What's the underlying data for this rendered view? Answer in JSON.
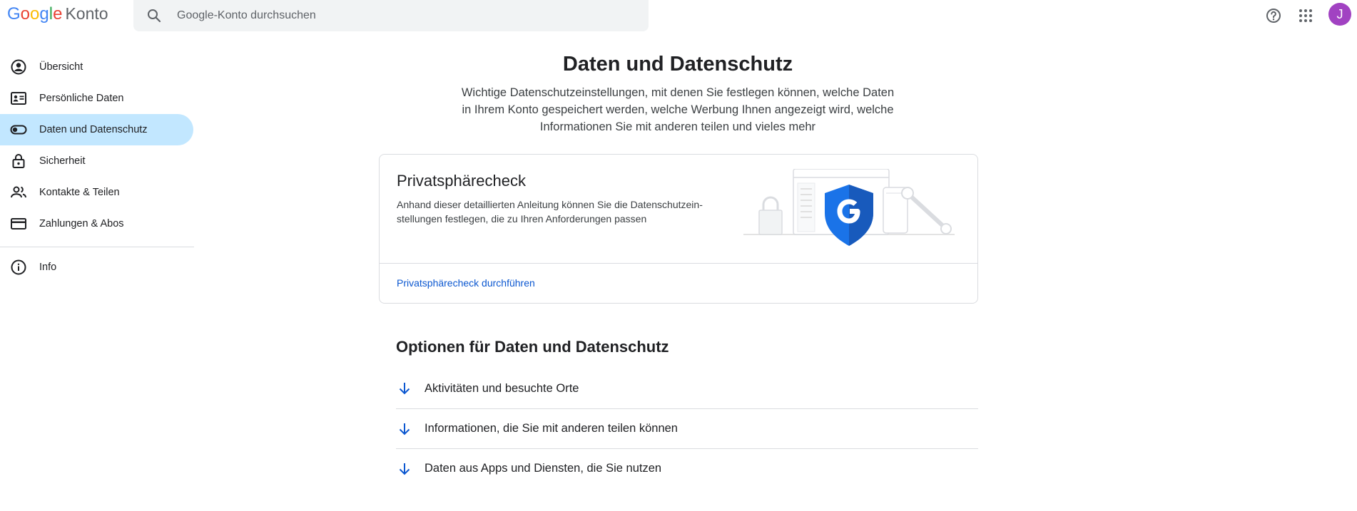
{
  "header": {
    "logo_letters": [
      "G",
      "o",
      "o",
      "g",
      "l",
      "e"
    ],
    "logo_colors": [
      "#4285f4",
      "#ea4335",
      "#fbbc05",
      "#4285f4",
      "#34a853",
      "#ea4335"
    ],
    "product": "Konto",
    "search_placeholder": "Google-Konto durchsuchen",
    "search_value": "",
    "icons": [
      "search-icon",
      "help-icon",
      "apps-grid-icon"
    ],
    "avatar_initial": "J",
    "avatar_color": "#a142c2"
  },
  "sidebar": {
    "active_color": "#c2e7ff",
    "items": [
      {
        "label": "Übersicht",
        "icon": "account-circle-icon",
        "active": false
      },
      {
        "label": "Persönliche Daten",
        "icon": "id-card-icon",
        "active": false
      },
      {
        "label": "Daten und Datenschutz",
        "icon": "toggle-icon",
        "active": true
      },
      {
        "label": "Sicherheit",
        "icon": "lock-icon",
        "active": false
      },
      {
        "label": "Kontakte & Teilen",
        "icon": "people-icon",
        "active": false
      },
      {
        "label": "Zahlungen & Abos",
        "icon": "credit-card-icon",
        "active": false
      }
    ],
    "secondary_items": [
      {
        "label": "Info",
        "icon": "info-icon"
      }
    ]
  },
  "main": {
    "title": "Daten und Datenschutz",
    "subtitle": "Wichtige Datenschutzeinstellungen, mit denen Sie festlegen können, welche Daten in Ihrem Konto gespeichert werden, welche Werbung Ihnen angezeigt wird, welche Informationen Sie mit anderen teilen und vieles mehr",
    "privacy_card": {
      "title": "Privatsphärecheck",
      "description": "Anhand dieser detaillierten Anleitung können Sie die Datenschutzein­stellungen festlegen, die zu Ihren Anforderungen passen",
      "link": "Privatsphärecheck durchführen",
      "link_color": "#0b57d0",
      "illustration": "google-shield-icon"
    },
    "options_section": {
      "title": "Optionen für Daten und Datenschutz",
      "items": [
        {
          "label": "Aktivitäten und besuchte Orte"
        },
        {
          "label": "Informationen, die Sie mit anderen teilen können"
        },
        {
          "label": "Daten aus Apps und Diensten, die Sie nutzen"
        }
      ],
      "arrow_color": "#0b57d0"
    }
  }
}
